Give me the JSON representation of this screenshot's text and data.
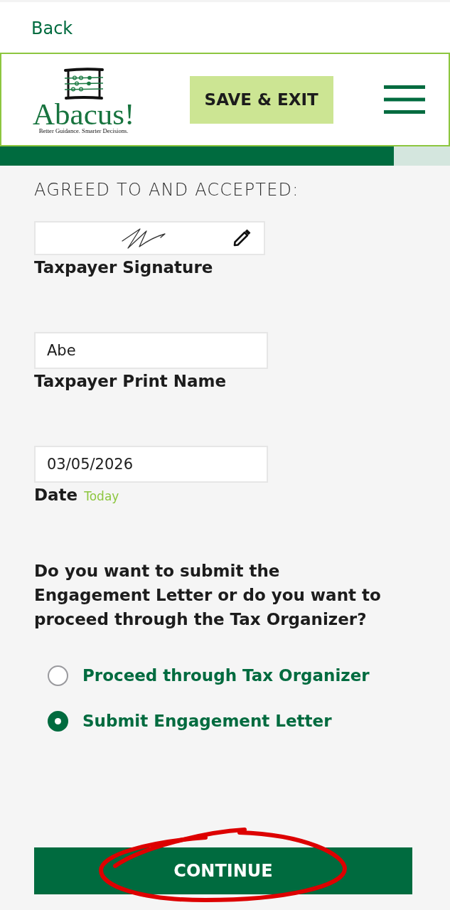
{
  "back_link": "Back",
  "header": {
    "logo": {
      "name": "Abacus!",
      "tagline": "Better Guidance. Smarter Decisions."
    },
    "save_button": "SAVE & EXIT"
  },
  "progress": {
    "level": 0.875
  },
  "agreement": {
    "heading": "AGREED TO AND ACCEPTED:",
    "fields": [
      {
        "kind": "signature",
        "label": "Taxpayer Signature"
      },
      {
        "kind": "text",
        "value": "Abe",
        "label": "Taxpayer Print Name"
      },
      {
        "kind": "date",
        "value": "03/05/2026",
        "label": "Date",
        "hint": "Today"
      }
    ]
  },
  "question": {
    "text": "Do you want to submit the Engagement Letter or do you want to proceed through the Tax Organizer?",
    "options": [
      {
        "label": "Proceed through Tax Organizer",
        "selected": false
      },
      {
        "label": "Submit Engagement Letter",
        "selected": true
      }
    ]
  },
  "continue_button": {
    "label": "CONTINUE",
    "circled": true
  }
}
